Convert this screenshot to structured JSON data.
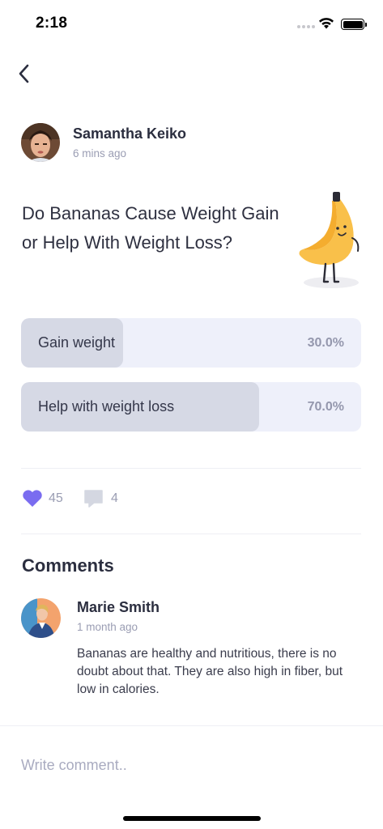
{
  "status_bar": {
    "time": "2:18"
  },
  "post": {
    "author_name": "Samantha Keiko",
    "time_ago": "6 mins ago",
    "question": "Do Bananas Cause Weight Gain or Help With Weight Loss?",
    "poll": [
      {
        "label": "Gain weight",
        "percent_text": "30.0%",
        "fraction": 0.3
      },
      {
        "label": "Help with weight loss",
        "percent_text": "70.0%",
        "fraction": 0.7
      }
    ],
    "likes": "45",
    "comments_count": "4"
  },
  "comments_section": {
    "title": "Comments",
    "items": [
      {
        "name": "Marie Smith",
        "time_ago": "1 month ago",
        "text": "Bananas are healthy and nutritious, there is no doubt about that. They are also high in fiber, but low in calories."
      }
    ]
  },
  "comment_input": {
    "placeholder": "Write comment.."
  },
  "colors": {
    "accent": "#7a6cf0",
    "poll_fill": "#d6d9e5",
    "poll_track": "#eef0fa",
    "banana": "#f9c04a"
  },
  "icons": [
    "back-chevron-icon",
    "heart-icon",
    "comment-bubble-icon",
    "wifi-icon",
    "battery-icon",
    "signal-icon"
  ]
}
